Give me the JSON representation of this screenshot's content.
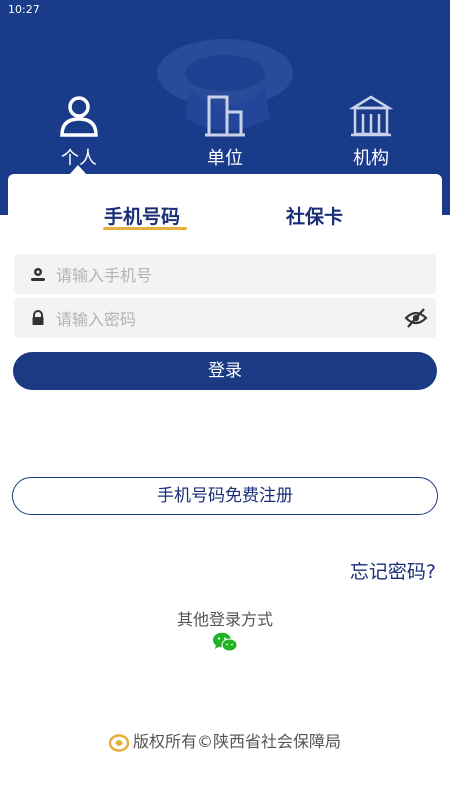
{
  "status_bar": {
    "time": "10:27"
  },
  "colors": {
    "primary": "#1b3a84",
    "accent_underline": "#e7ae3c",
    "wechat_green": "#21b321"
  },
  "roles": [
    {
      "label": "个人",
      "icon": "person-icon",
      "selected": true
    },
    {
      "label": "单位",
      "icon": "building-icon",
      "selected": false
    },
    {
      "label": "机构",
      "icon": "institution-icon",
      "selected": false
    }
  ],
  "tabs": [
    {
      "label": "手机号码",
      "selected": true
    },
    {
      "label": "社保卡",
      "selected": false
    }
  ],
  "form": {
    "phone": {
      "placeholder": "请输入手机号",
      "value": ""
    },
    "password": {
      "placeholder": "请输入密码",
      "value": ""
    },
    "login_label": "登录",
    "register_label": "手机号码免费注册",
    "forgot_label": "忘记密码?"
  },
  "other_login": {
    "title": "其他登录方式",
    "icon": "wechat-icon"
  },
  "footer": {
    "text": "版权所有©陕西省社会保障局",
    "icon": "ssb-logo-icon"
  }
}
